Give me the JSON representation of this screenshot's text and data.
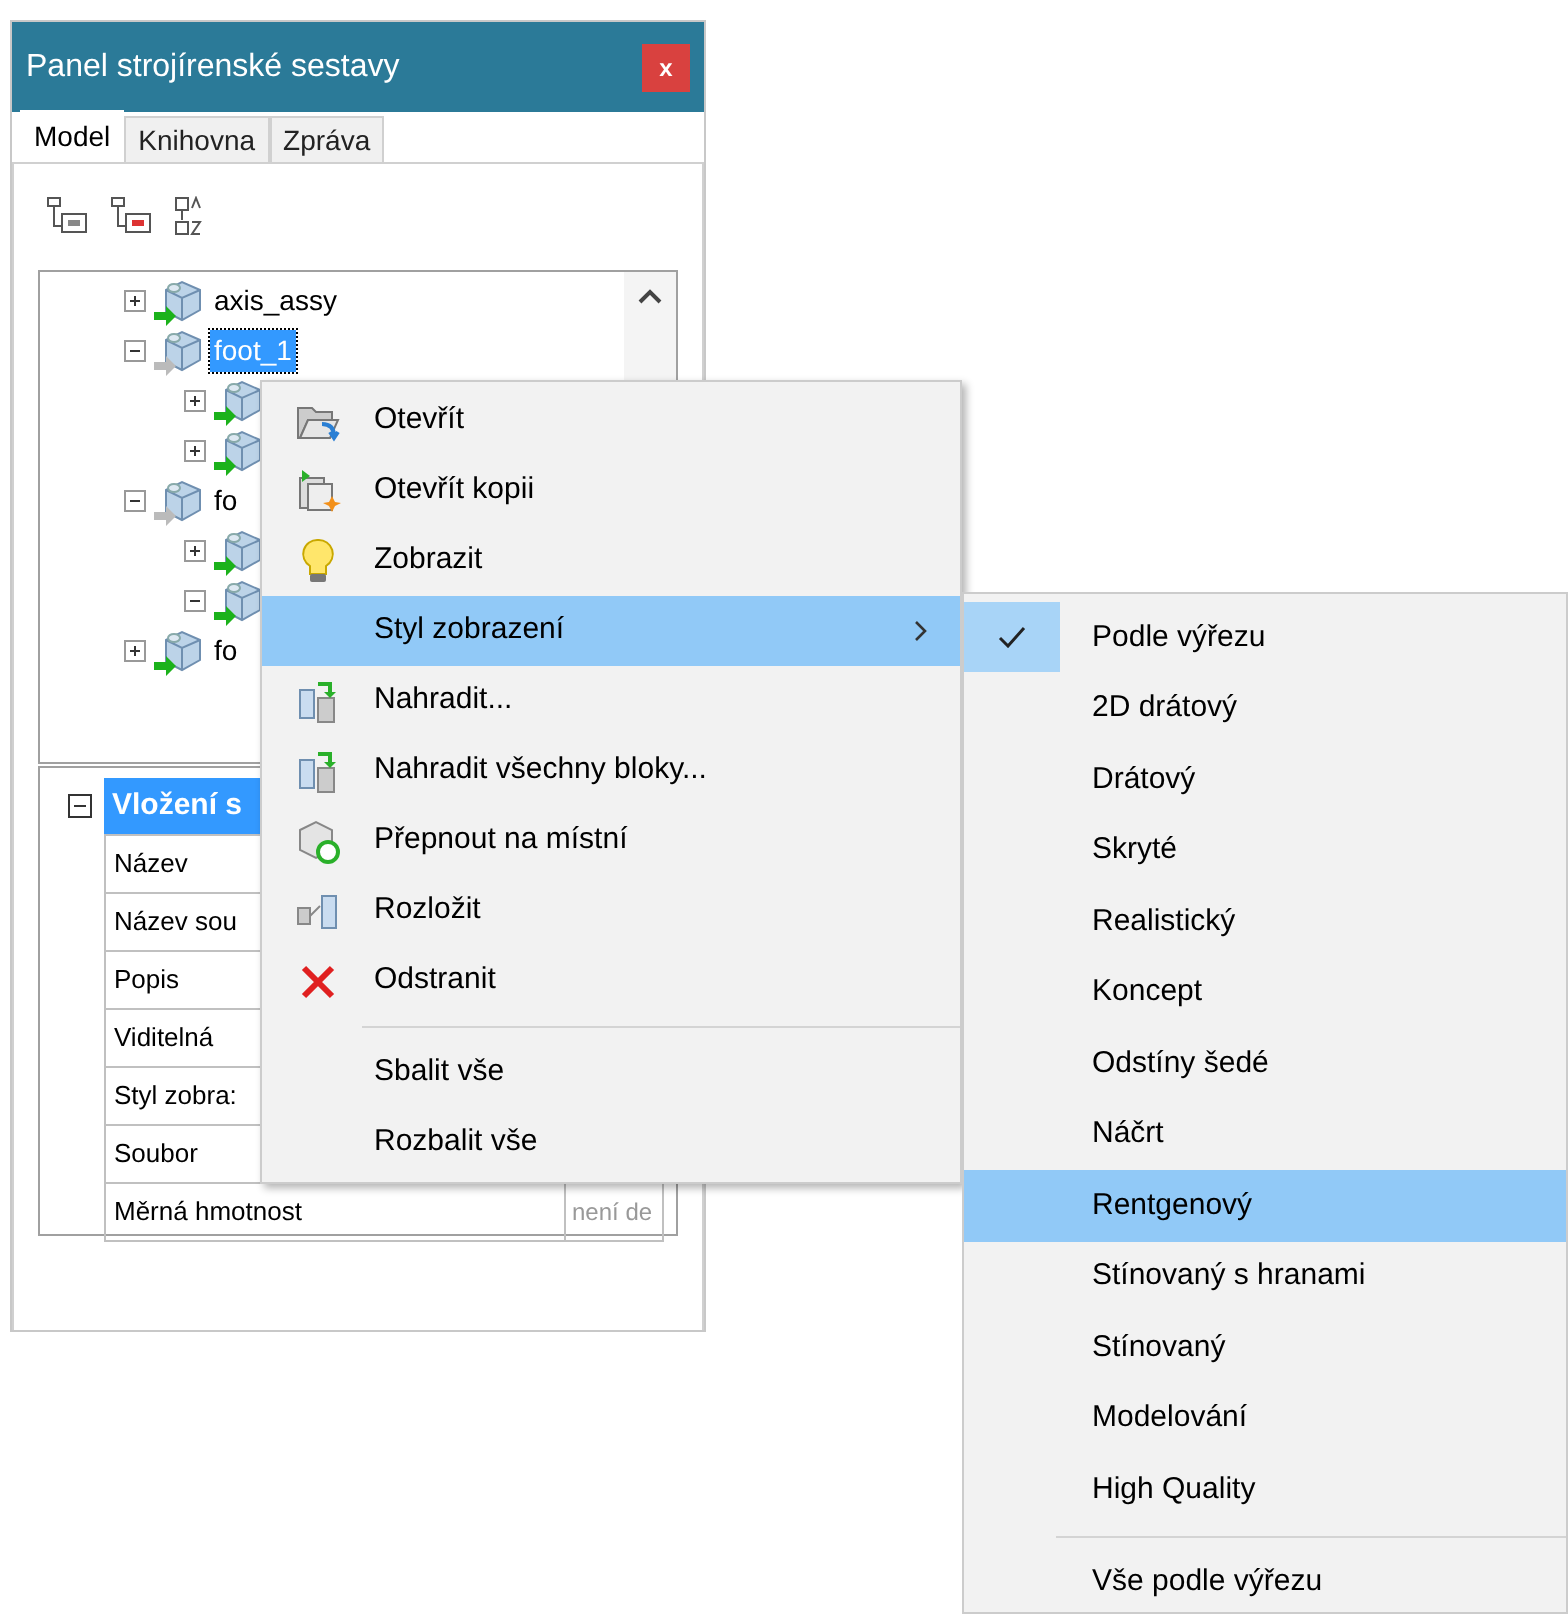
{
  "window": {
    "title": "Panel strojírenské sestavy",
    "close_label": "x"
  },
  "tabs": [
    {
      "label": "Model",
      "selected": true
    },
    {
      "label": "Knihovna",
      "selected": false
    },
    {
      "label": "Zpráva",
      "selected": false
    }
  ],
  "tree": [
    {
      "label": "axis_assy",
      "expanded": false,
      "selected": false,
      "linked": true
    },
    {
      "label": "foot_1",
      "expanded": true,
      "selected": true,
      "linked": false,
      "children": [
        {
          "expanded": false,
          "linked": true
        },
        {
          "expanded": false,
          "linked": true
        }
      ]
    },
    {
      "label": "fo",
      "expanded": true,
      "selected": false,
      "linked": false,
      "children": [
        {
          "expanded": false,
          "linked": true
        },
        {
          "expanded": true,
          "linked": true
        }
      ]
    },
    {
      "label": "fo",
      "expanded": false,
      "selected": false,
      "linked": true
    }
  ],
  "properties": {
    "section": "Vložení s",
    "expanded": true,
    "rows": [
      {
        "name": "Název"
      },
      {
        "name": "Název sou"
      },
      {
        "name": "Popis"
      },
      {
        "name": "Viditelná"
      },
      {
        "name": "Styl zobra:"
      },
      {
        "name": "Soubor"
      },
      {
        "name": "Měrná hmotnost",
        "value": "není de"
      }
    ]
  },
  "context_menu": [
    {
      "kind": "item",
      "label": "Otevřít",
      "selected": false
    },
    {
      "kind": "item",
      "label": "Otevřít kopii",
      "selected": false
    },
    {
      "kind": "item",
      "label": "Zobrazit",
      "selected": false
    },
    {
      "kind": "item",
      "label": "Styl zobrazení",
      "submenu": true,
      "selected": true
    },
    {
      "kind": "item",
      "label": "Nahradit...",
      "selected": false
    },
    {
      "kind": "item",
      "label": "Nahradit všechny bloky...",
      "selected": false
    },
    {
      "kind": "item",
      "label": "Přepnout na místní",
      "selected": false
    },
    {
      "kind": "item",
      "label": "Rozložit",
      "selected": false
    },
    {
      "kind": "item",
      "label": "Odstranit",
      "selected": false
    },
    {
      "kind": "separator"
    },
    {
      "kind": "item",
      "label": "Sbalit vše",
      "selected": false
    },
    {
      "kind": "item",
      "label": "Rozbalit vše",
      "selected": false
    }
  ],
  "submenu": [
    {
      "kind": "item",
      "label": "Podle výřezu",
      "checked": true,
      "selected": false
    },
    {
      "kind": "item",
      "label": "2D drátový",
      "checked": false,
      "selected": false
    },
    {
      "kind": "item",
      "label": "Drátový",
      "checked": false,
      "selected": false
    },
    {
      "kind": "item",
      "label": "Skryté",
      "checked": false,
      "selected": false
    },
    {
      "kind": "item",
      "label": "Realistický",
      "checked": false,
      "selected": false
    },
    {
      "kind": "item",
      "label": "Koncept",
      "checked": false,
      "selected": false
    },
    {
      "kind": "item",
      "label": "Odstíny šedé",
      "checked": false,
      "selected": false
    },
    {
      "kind": "item",
      "label": "Náčrt",
      "checked": false,
      "selected": false
    },
    {
      "kind": "item",
      "label": "Rentgenový",
      "checked": false,
      "selected": true
    },
    {
      "kind": "item",
      "label": "Stínovaný s hranami",
      "checked": false,
      "selected": false
    },
    {
      "kind": "item",
      "label": "Stínovaný",
      "checked": false,
      "selected": false
    },
    {
      "kind": "item",
      "label": "Modelování",
      "checked": false,
      "selected": false
    },
    {
      "kind": "item",
      "label": "High Quality",
      "checked": false,
      "selected": false
    },
    {
      "kind": "separator"
    },
    {
      "kind": "item",
      "label": "Vše podle výřezu",
      "checked": false,
      "selected": false
    }
  ]
}
